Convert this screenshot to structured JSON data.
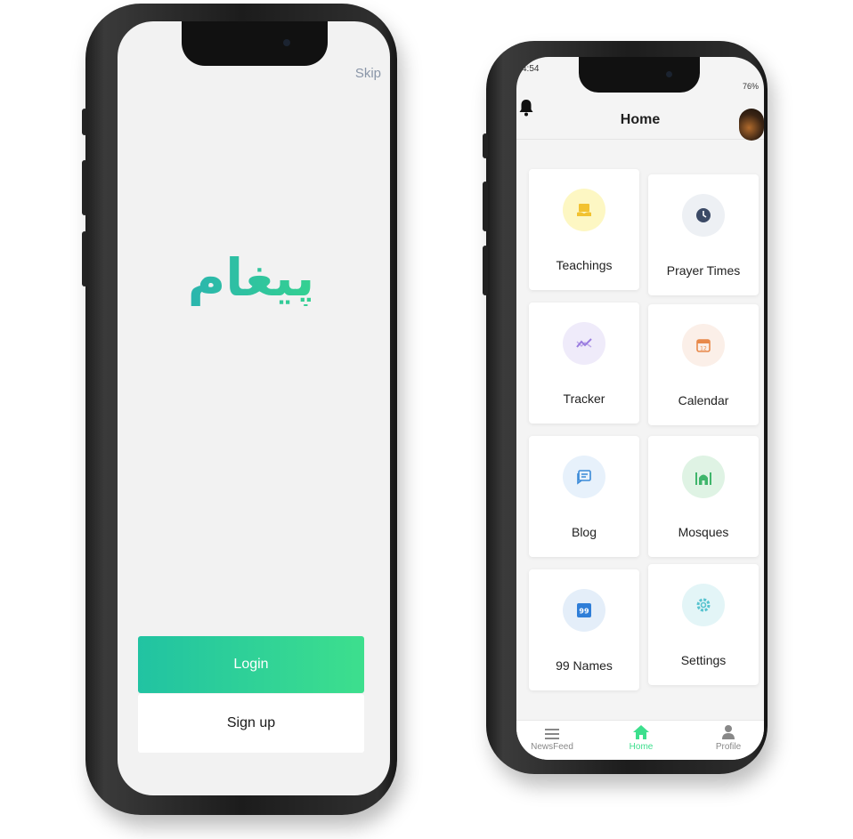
{
  "screen_left": {
    "skip_label": "Skip",
    "logo_text": "پیغام",
    "login_label": "Login",
    "signup_label": "Sign up",
    "brand_gradient": [
      "#21c3a2",
      "#3ddf8d"
    ]
  },
  "screen_right": {
    "status": {
      "time": "4:54",
      "battery": "76%"
    },
    "header": {
      "title": "Home"
    },
    "tiles": [
      {
        "label": "Teachings",
        "icon": "teachings-icon",
        "bg": "#fdf7c3",
        "color": "#f2c230"
      },
      {
        "label": "Prayer Times",
        "icon": "clock-icon",
        "bg": "#edf0f4",
        "color": "#3b4a66"
      },
      {
        "label": "Tracker",
        "icon": "tracker-icon",
        "bg": "#efebfa",
        "color": "#9a7ce0"
      },
      {
        "label": "Calendar",
        "icon": "calendar-icon",
        "bg": "#fbefe8",
        "color": "#e8894a"
      },
      {
        "label": "Blog",
        "icon": "blog-icon",
        "bg": "#e7f1fb",
        "color": "#3a8ad8"
      },
      {
        "label": "Mosques",
        "icon": "mosque-icon",
        "bg": "#dff3e4",
        "color": "#3fb56b"
      },
      {
        "label": "99 Names",
        "icon": "names-icon",
        "bg": "#e4eef9",
        "color": "#2f7ed8"
      },
      {
        "label": "Settings",
        "icon": "gear-icon",
        "bg": "#e3f5f7",
        "color": "#57c3cf"
      }
    ],
    "nav": {
      "newsfeed": "NewsFeed",
      "home": "Home",
      "profile": "Profile",
      "active_color": "#3ddf8d"
    }
  }
}
